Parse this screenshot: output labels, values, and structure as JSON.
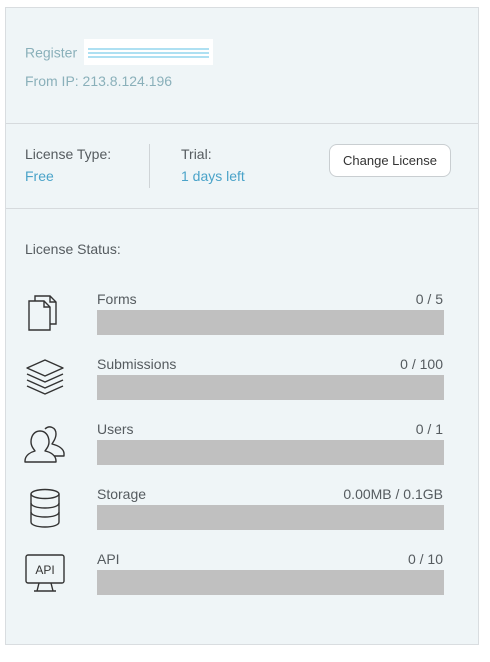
{
  "header": {
    "register_label": "Register",
    "ip_text": "From IP: 213.8.124.196"
  },
  "license": {
    "type_label": "License Type:",
    "type_value": "Free",
    "trial_label": "Trial:",
    "trial_value": "1 days left",
    "change_button": "Change License"
  },
  "status": {
    "heading": "License Status:",
    "items": [
      {
        "label": "Forms",
        "count": "0 / 5",
        "icon": "documents-icon",
        "fill": 0
      },
      {
        "label": "Submissions",
        "count": "0 / 100",
        "icon": "layers-icon",
        "fill": 0
      },
      {
        "label": "Users",
        "count": "0 / 1",
        "icon": "users-icon",
        "fill": 0
      },
      {
        "label": "Storage",
        "count": "0.00MB / 0.1GB",
        "icon": "database-icon",
        "fill": 0
      },
      {
        "label": "API",
        "count": "0 / 10",
        "icon": "api-monitor-icon",
        "fill": 0
      }
    ]
  },
  "colors": {
    "accent": "#4aa3c9",
    "muted": "#8ab0ba",
    "bar_track": "#c0c0c0",
    "panel_bg": "#eff5f7"
  }
}
